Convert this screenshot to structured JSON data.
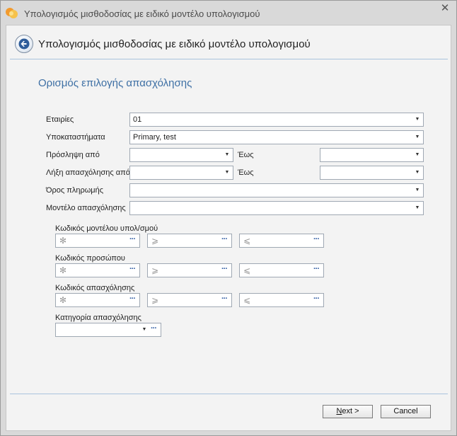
{
  "window": {
    "title": "Υπολογισμός μισθοδοσίας με ειδικό μοντέλο υπολογισμού"
  },
  "header": {
    "title": "Υπολογισμός μισθοδοσίας με ειδικό μοντέλο υπολογισμού"
  },
  "section": {
    "title": "Ορισμός επιλογής απασχόλησης"
  },
  "form": {
    "companies": {
      "label": "Εταιρίες",
      "value": "01"
    },
    "branches": {
      "label": "Υποκαταστήματα",
      "value": "Primary, test"
    },
    "hire_from": {
      "label": "Πρόσληψη από",
      "value": ""
    },
    "hire_to": {
      "label": "Έως",
      "value": ""
    },
    "end_from": {
      "label": "Λήξη απασχόλησης από",
      "value": ""
    },
    "end_to": {
      "label": "Έως",
      "value": ""
    },
    "payment_term": {
      "label": "Όρος πληρωμής",
      "value": ""
    },
    "employment_model": {
      "label": "Μοντέλο απασχόλησης",
      "value": ""
    }
  },
  "ranges": {
    "calc_model_code": {
      "label": "Κωδικός μοντέλου υπολ/σμού"
    },
    "person_code": {
      "label": "Κωδικός προσώπου"
    },
    "employment_code": {
      "label": "Κωδικός απασχόλησης"
    },
    "employment_category": {
      "label": "Κατηγορία απασχόλησης",
      "value": ""
    },
    "prefix_all": "✻",
    "prefix_from": "⩾",
    "prefix_to": "⩽",
    "dots": "···"
  },
  "buttons": {
    "next": "Next >",
    "cancel": "Cancel"
  },
  "glyphs": {
    "close": "✕",
    "dropdown": "▼"
  },
  "colors": {
    "section_title": "#3d6fa4",
    "separator": "#a9c3dd",
    "ellipsis": "#2a57a0"
  }
}
